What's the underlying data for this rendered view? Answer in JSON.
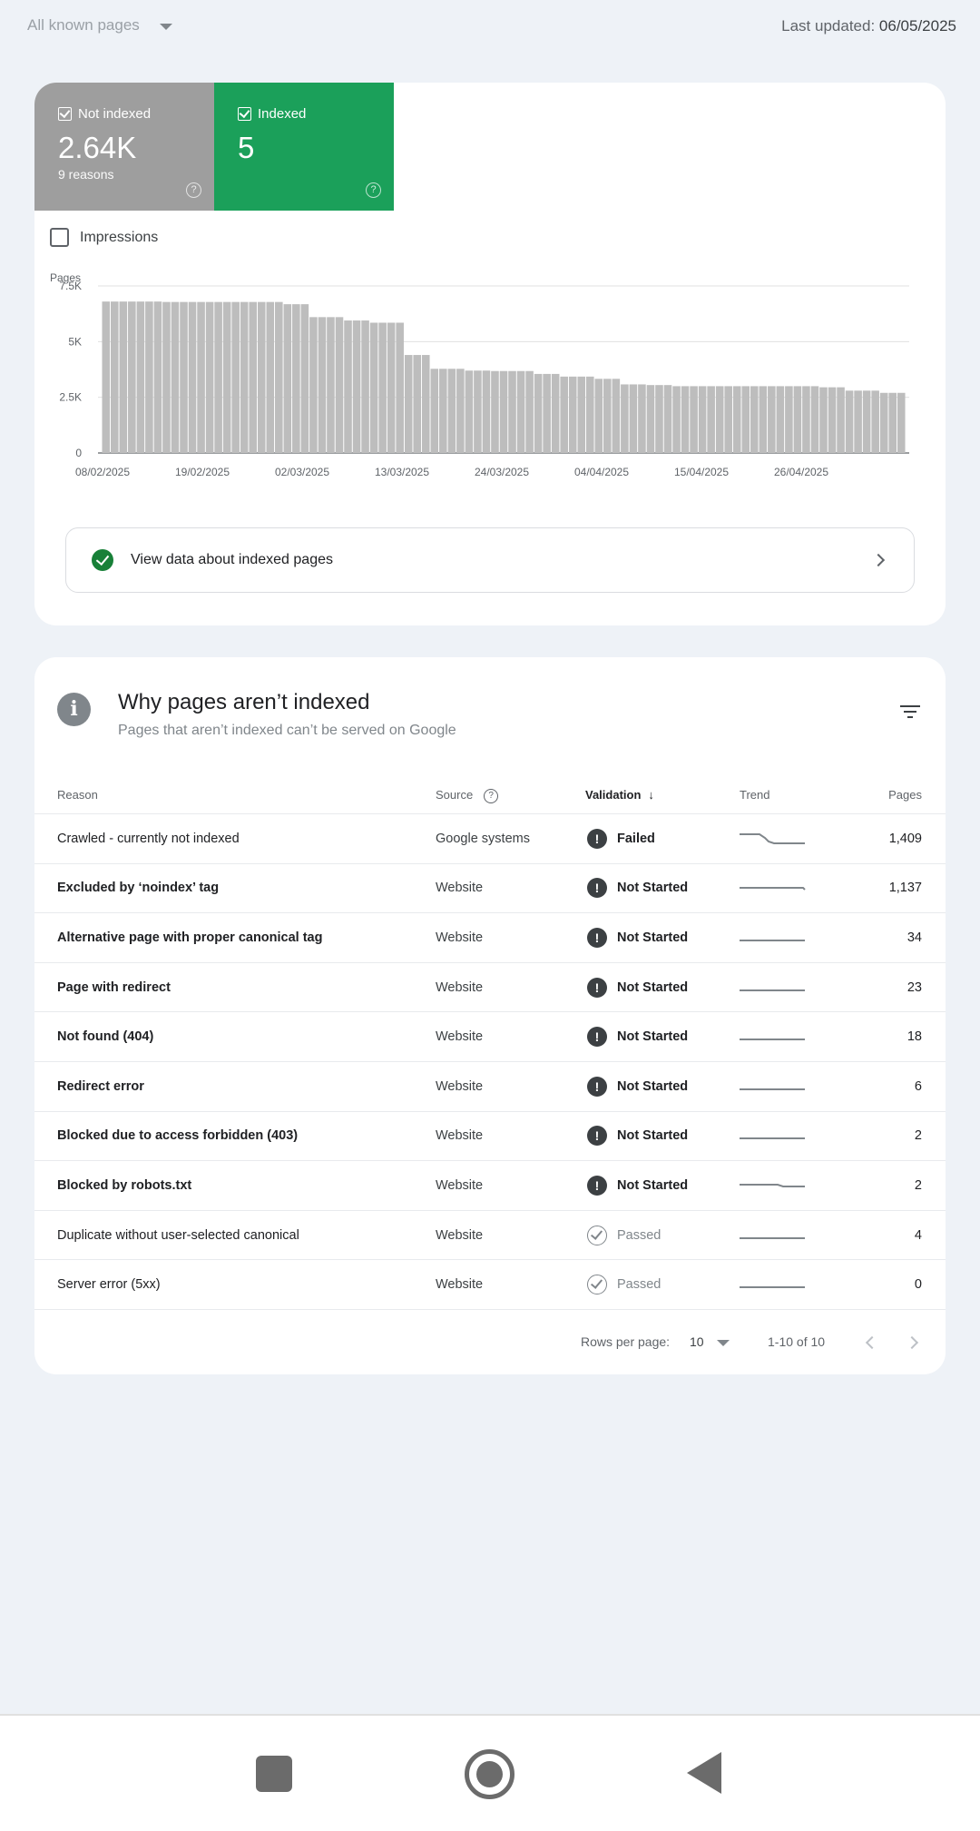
{
  "topbar": {
    "page_filter": "All known pages",
    "last_updated_label": "Last updated:",
    "last_updated_value": "06/05/2025"
  },
  "summary": {
    "not_indexed": {
      "label": "Not indexed",
      "value": "2.64K",
      "sub": "9 reasons",
      "color": "#9e9e9e"
    },
    "indexed": {
      "label": "Indexed",
      "value": "5",
      "color": "#1ba05a"
    },
    "impressions_label": "Impressions"
  },
  "chart_data": {
    "type": "bar",
    "ylabel": "Pages",
    "yticks": [
      "0",
      "2.5K",
      "5K",
      "7.5K"
    ],
    "ylim": [
      0,
      7500
    ],
    "x_tick_labels": [
      "08/02/2025",
      "19/02/2025",
      "02/03/2025",
      "13/03/2025",
      "24/03/2025",
      "04/04/2025",
      "15/04/2025",
      "26/04/2025"
    ],
    "bar_color": "#bdbdbd",
    "values": [
      6800,
      6800,
      6800,
      6800,
      6800,
      6800,
      6800,
      6780,
      6780,
      6780,
      6780,
      6780,
      6780,
      6780,
      6780,
      6780,
      6780,
      6780,
      6780,
      6780,
      6780,
      6680,
      6680,
      6680,
      6100,
      6100,
      6100,
      6100,
      5950,
      5950,
      5950,
      5850,
      5850,
      5850,
      5850,
      4400,
      4400,
      4400,
      3780,
      3780,
      3780,
      3780,
      3700,
      3700,
      3700,
      3680,
      3680,
      3680,
      3680,
      3680,
      3550,
      3550,
      3550,
      3430,
      3430,
      3430,
      3430,
      3330,
      3330,
      3330,
      3080,
      3080,
      3080,
      3050,
      3050,
      3050,
      3000,
      3000,
      3000,
      3000,
      3000,
      3000,
      3000,
      3000,
      3000,
      3000,
      3000,
      3000,
      3000,
      3000,
      3000,
      3000,
      3000,
      2950,
      2950,
      2950,
      2800,
      2800,
      2800,
      2800,
      2700,
      2700,
      2700
    ]
  },
  "view_data": {
    "label": "View data about indexed pages"
  },
  "why": {
    "title": "Why pages aren’t indexed",
    "subtitle": "Pages that aren’t indexed can’t be served on Google",
    "columns": {
      "reason": "Reason",
      "source": "Source",
      "validation": "Validation",
      "trend": "Trend",
      "pages": "Pages"
    },
    "rows": [
      {
        "reason": "Crawled - currently not indexed",
        "source": "Google systems",
        "validation": "Failed",
        "pages": "1,409"
      },
      {
        "reason": "Excluded by ‘noindex’ tag",
        "source": "Website",
        "validation": "Not Started",
        "pages": "1,137"
      },
      {
        "reason": "Alternative page with proper canonical tag",
        "source": "Website",
        "validation": "Not Started",
        "pages": "34"
      },
      {
        "reason": "Page with redirect",
        "source": "Website",
        "validation": "Not Started",
        "pages": "23"
      },
      {
        "reason": "Not found (404)",
        "source": "Website",
        "validation": "Not Started",
        "pages": "18"
      },
      {
        "reason": "Redirect error",
        "source": "Website",
        "validation": "Not Started",
        "pages": "6"
      },
      {
        "reason": "Blocked due to access forbidden (403)",
        "source": "Website",
        "validation": "Not Started",
        "pages": "2"
      },
      {
        "reason": "Blocked by robots.txt",
        "source": "Website",
        "validation": "Not Started",
        "pages": "2"
      },
      {
        "reason": "Duplicate without user-selected canonical",
        "source": "Website",
        "validation": "Passed",
        "pages": "4"
      },
      {
        "reason": "Server error (5xx)",
        "source": "Website",
        "validation": "Passed",
        "pages": "0"
      }
    ],
    "pager": {
      "rows_per_page_label": "Rows per page:",
      "rows_per_page": "10",
      "range": "1-10 of 10"
    }
  }
}
